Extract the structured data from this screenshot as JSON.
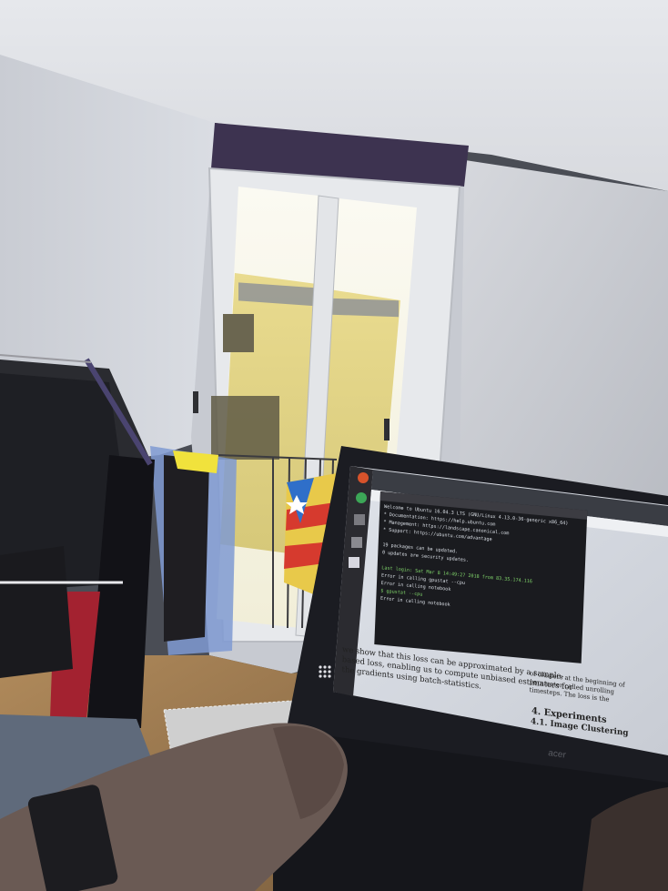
{
  "scene": {
    "description_tags": [
      "room",
      "balcony-door",
      "laptop",
      "clothes-rack",
      "hand"
    ]
  },
  "laptop_screen": {
    "paper": {
      "body_lines": [
        "we show that this loss can be approximated by a sample-",
        "based loss, enabling us to compute unbiased estimators for",
        "the gradients using batch-statistics."
      ],
      "right_lines": [
        "of clusters at the beginning of",
        "parameter called unrolling",
        "timesteps. The loss is the"
      ],
      "section_heading": "4. Experiments",
      "subsection_heading": "4.1. Image Clustering"
    },
    "terminal": {
      "lines": [
        "Welcome to Ubuntu 16.04.3 LTS (GNU/Linux 4.13.0-36-generic x86_64)",
        " * Documentation:  https://help.ubuntu.com",
        " * Management:     https://landscape.canonical.com",
        " * Support:        https://ubuntu.com/advantage",
        "",
        "19 packages can be updated.",
        "0 updates are security updates.",
        "",
        "Last login: Sat Mar  8 14:49:27 2018 from 83.35.174.116",
        "Error in calling gpustat --cpu",
        "Error in calling notebook",
        "$ gpustat --cpu",
        "Error in calling notebook"
      ]
    },
    "brand": "acer"
  }
}
